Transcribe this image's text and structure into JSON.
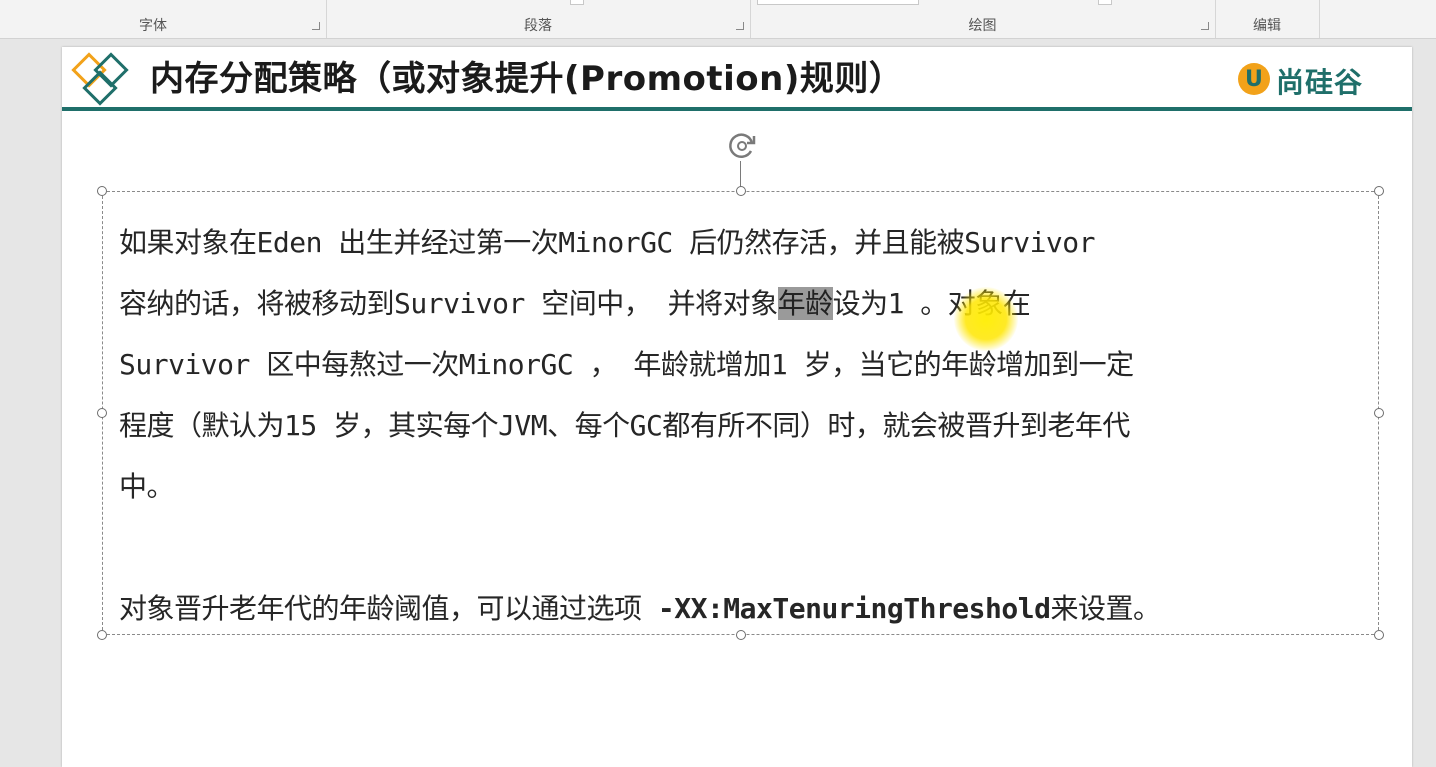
{
  "ribbon": {
    "groups": [
      {
        "label": "字体"
      },
      {
        "label": "段落"
      },
      {
        "label": "绘图"
      },
      {
        "label": "编辑"
      }
    ]
  },
  "slide": {
    "title": "内存分配策略（或对象提升(Promotion)规则）",
    "logo_text": "尚硅谷",
    "logo_mark": "U",
    "paragraph1": {
      "line1": "如果对象在Eden 出生并经过第一次MinorGC 后仍然存活，并且能被Survivor",
      "line2_before": "容纳的话，将被移动到Survivor 空间中， 并将对象",
      "line2_highlight": "年龄",
      "line2_after": "设为1 。对象在",
      "line3": "Survivor 区中每熬过一次MinorGC ， 年龄就增加1 岁，当它的年龄增加到一定",
      "line4": "程度（默认为15 岁，其实每个JVM、每个GC都有所不同）时，就会被晋升到老年代",
      "line5": "中。"
    },
    "paragraph2": {
      "text_before": "对象晋升老年代的年龄阈值，可以通过选项 ",
      "option": "-XX:MaxTenuringThreshold",
      "text_after": "来设置。"
    }
  },
  "colors": {
    "accent": "#1f6f6a",
    "logo_orange": "#f2a21a",
    "cursor_highlight": "#ffe600"
  }
}
